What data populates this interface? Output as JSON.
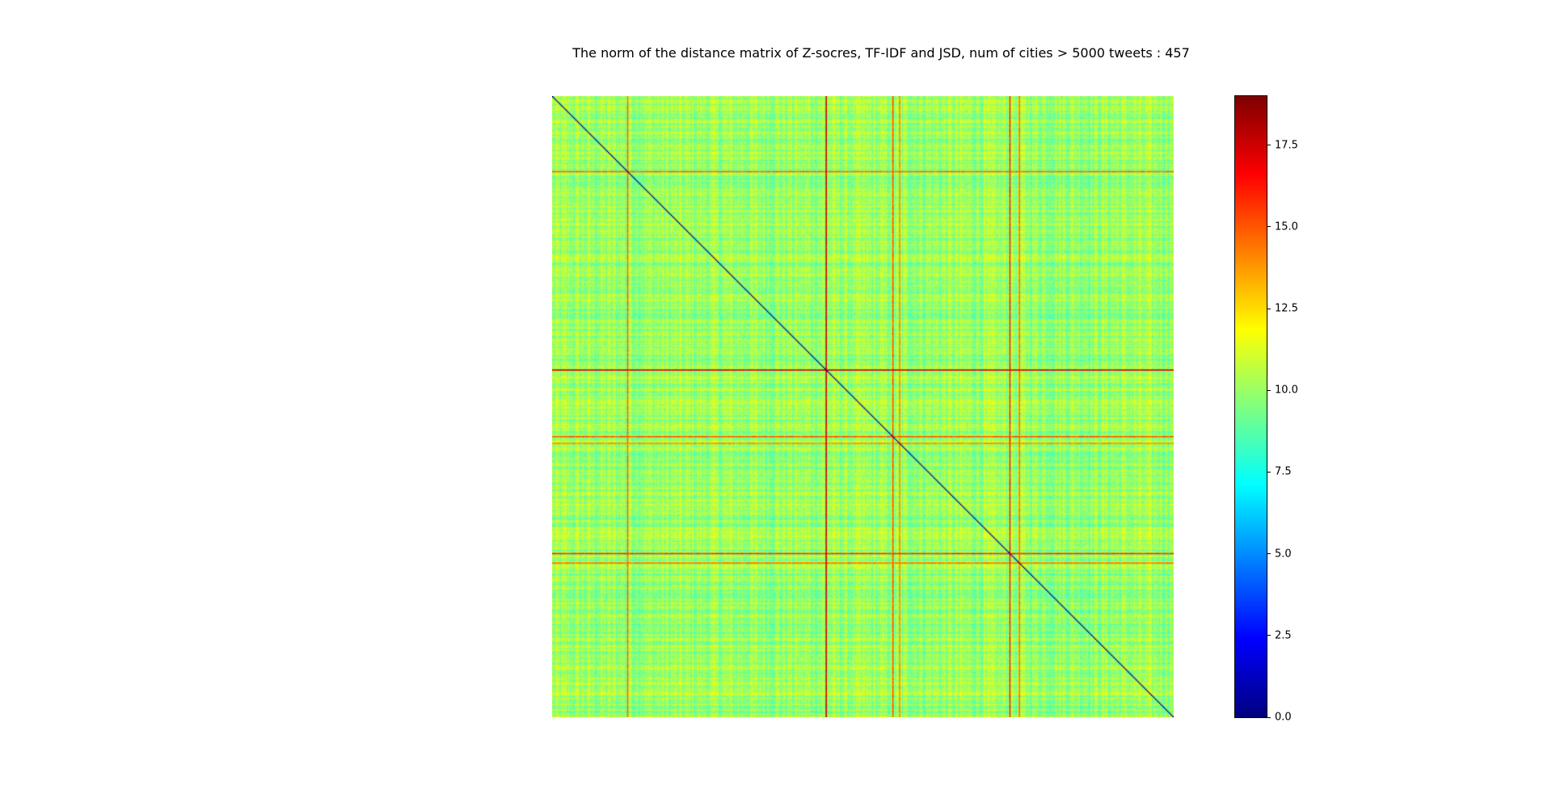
{
  "chart_data": {
    "type": "heatmap",
    "title": "The norm of the distance matrix of Z-socres, TF-IDF and JSD, num of cities > 5000 tweets : 457",
    "n": 457,
    "diagonal_value": 0.0,
    "background_value_range": [
      8.0,
      12.5
    ],
    "typical_value": 10.0,
    "highlighted_rows_cols": [
      {
        "index": 55,
        "value": 14.5
      },
      {
        "index": 201,
        "value": 17.5
      },
      {
        "index": 250,
        "value": 15.0
      },
      {
        "index": 255,
        "value": 14.0
      },
      {
        "index": 336,
        "value": 15.5
      },
      {
        "index": 343,
        "value": 14.5
      }
    ],
    "colormap": "jet",
    "colorbar": {
      "min": 0.0,
      "max": 19.0,
      "ticks": [
        "0.0",
        "2.5",
        "5.0",
        "7.5",
        "10.0",
        "12.5",
        "15.0",
        "17.5"
      ],
      "tick_values": [
        0.0,
        2.5,
        5.0,
        7.5,
        10.0,
        12.5,
        15.0,
        17.5
      ]
    }
  }
}
